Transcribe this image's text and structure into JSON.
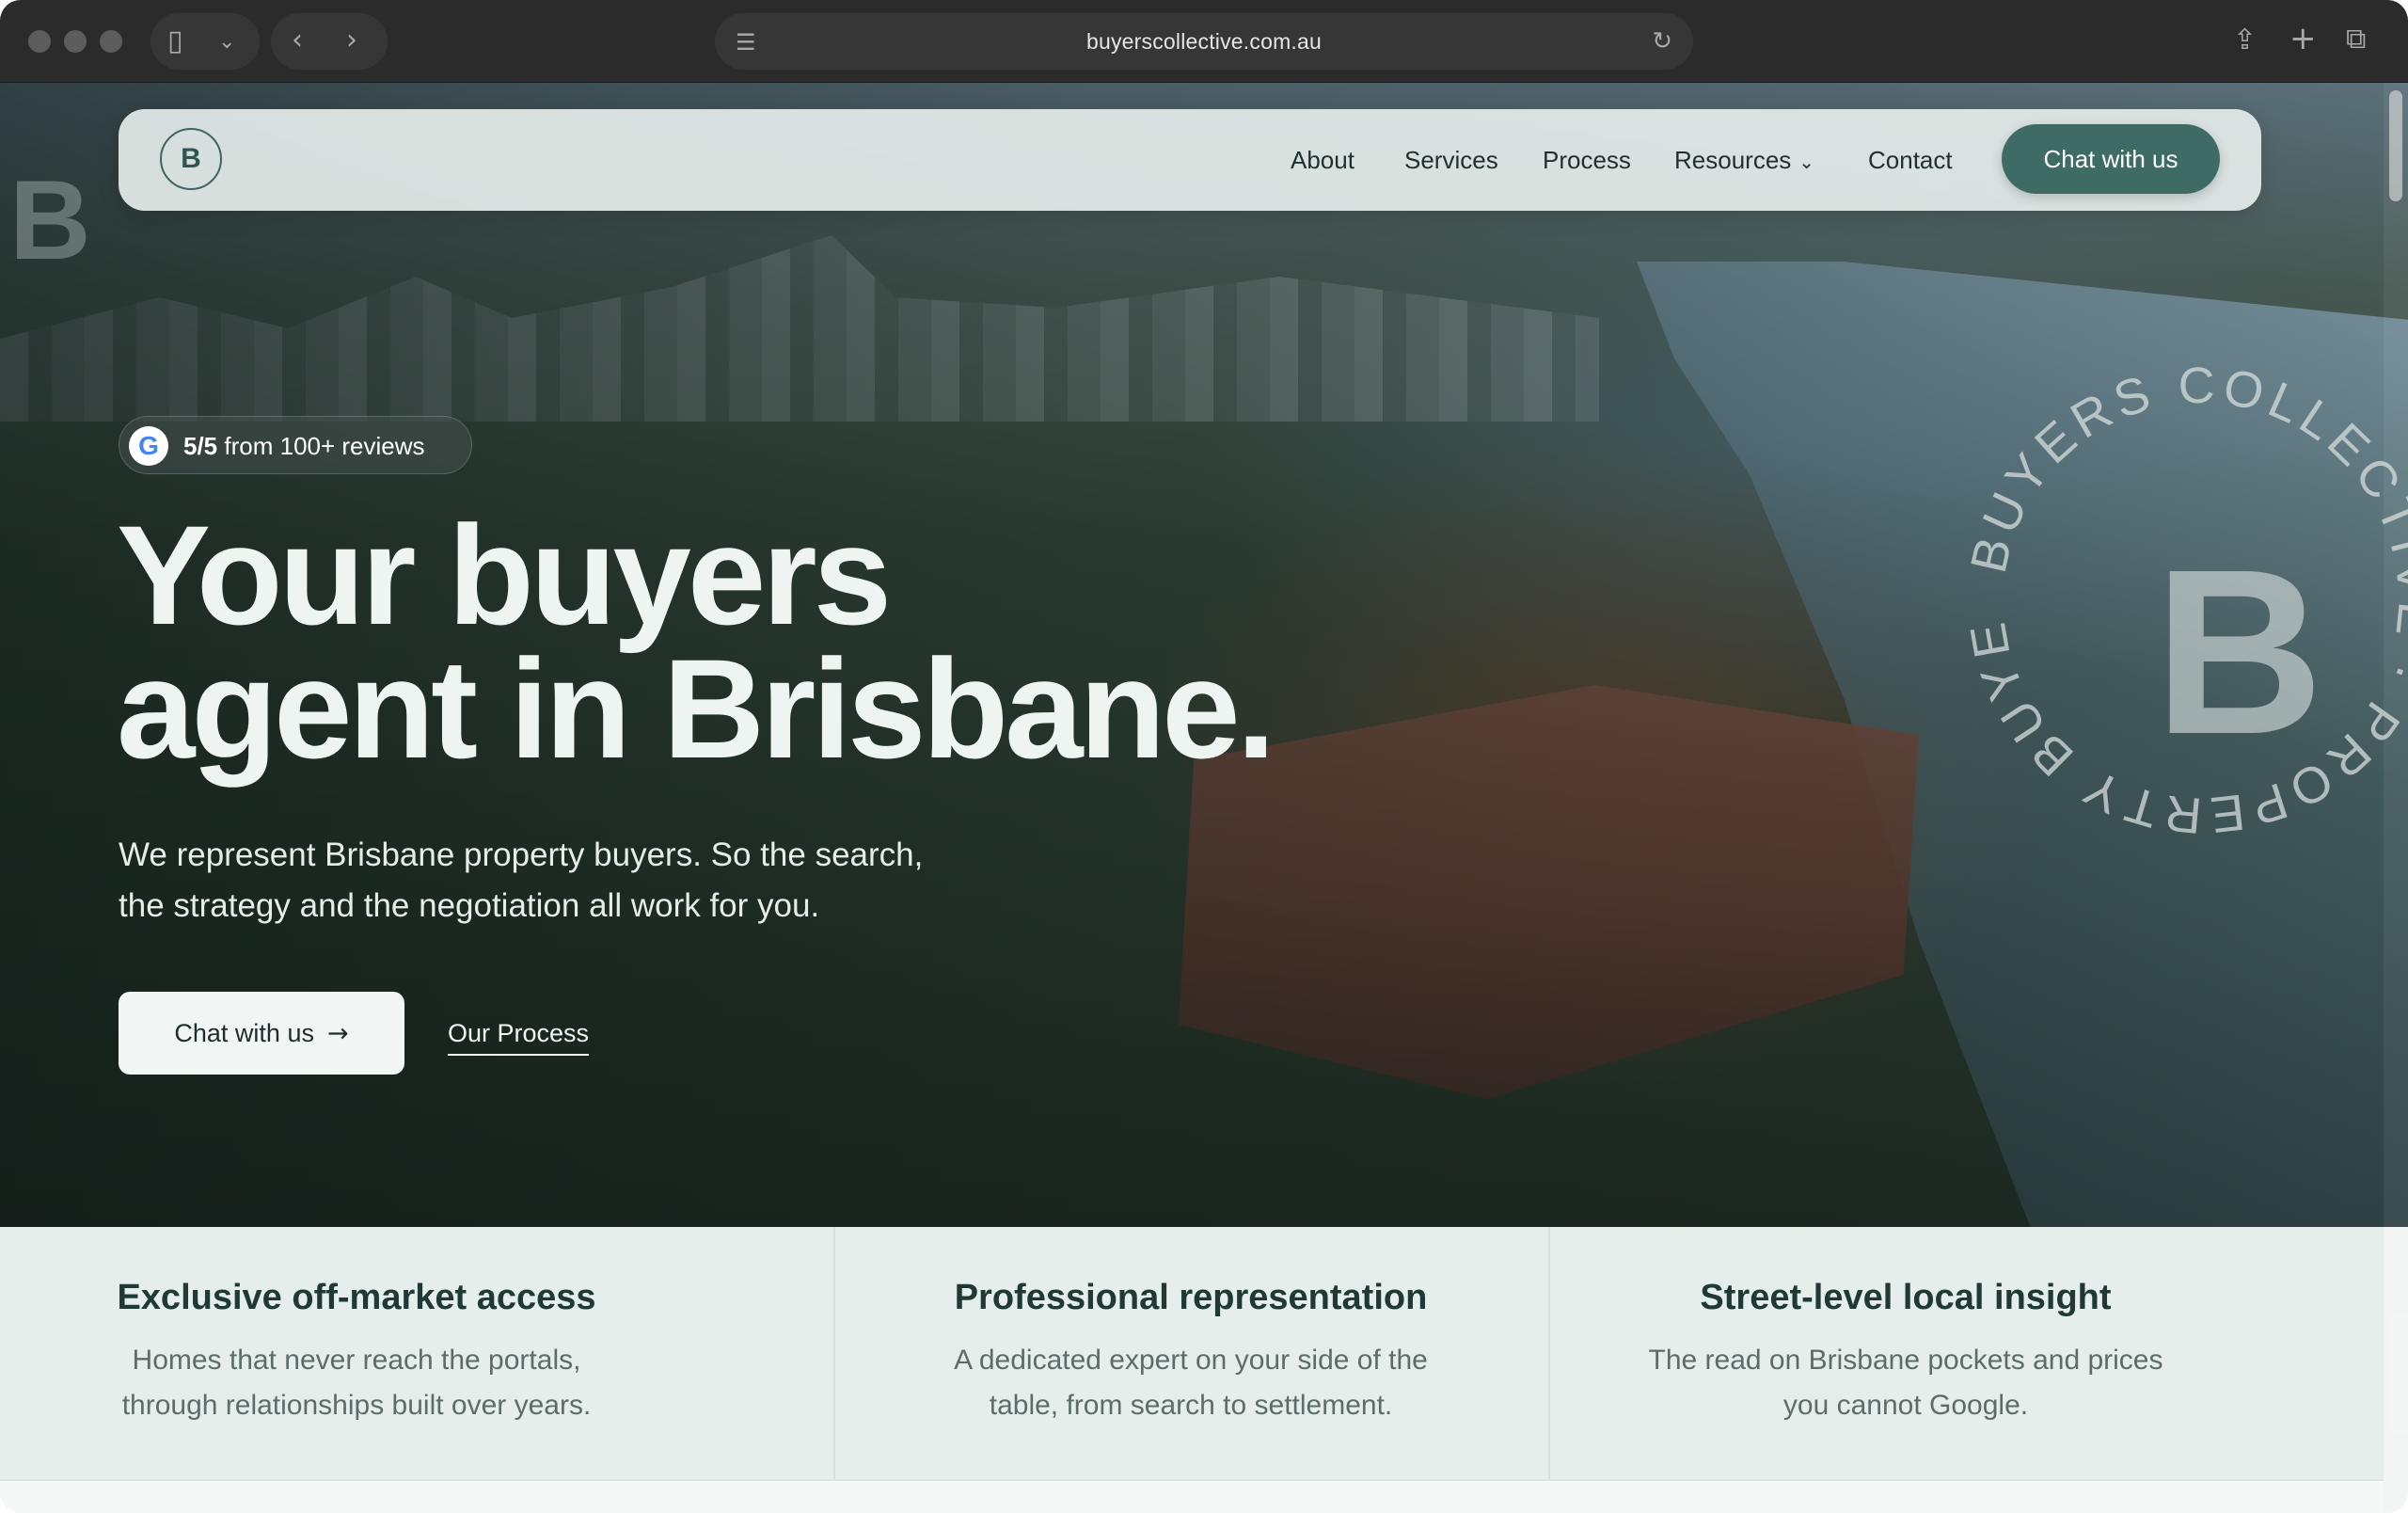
{
  "browser": {
    "url": "buyerscollective.com.au"
  },
  "nav": {
    "logo_text": "B",
    "links": [
      "About",
      "Services",
      "Process",
      "Resources",
      "Contact"
    ],
    "cta": "Chat with us"
  },
  "hero": {
    "review_score": "5/5",
    "review_text": "from 100+ reviews",
    "title_line1": "Your buyers",
    "title_line2": "agent in Brisbane.",
    "subtitle_line1": "We represent Brisbane property buyers. So the search,",
    "subtitle_line2": "the strategy and the negotiation all work for you.",
    "primary_cta": "Chat with us",
    "secondary_cta": "Our Process",
    "watermark_letter": "B",
    "watermark_ring": "BUYERS COLLECTIVE · PROPERTY BUYERS"
  },
  "features": [
    {
      "title": "Exclusive off-market access",
      "desc_line1": "Homes that never reach the portals,",
      "desc_line2": "through relationships built over years."
    },
    {
      "title": "Professional representation",
      "desc_line1": "A dedicated expert on your side of the",
      "desc_line2": "table, from search to settlement."
    },
    {
      "title": "Street-level local insight",
      "desc_line1": "The read on Brisbane pockets and prices",
      "desc_line2": "you cannot Google."
    }
  ],
  "colors": {
    "brand_green": "#3e6c65",
    "heading_green": "#1f3a35",
    "feature_bg": "#e6eeec"
  }
}
